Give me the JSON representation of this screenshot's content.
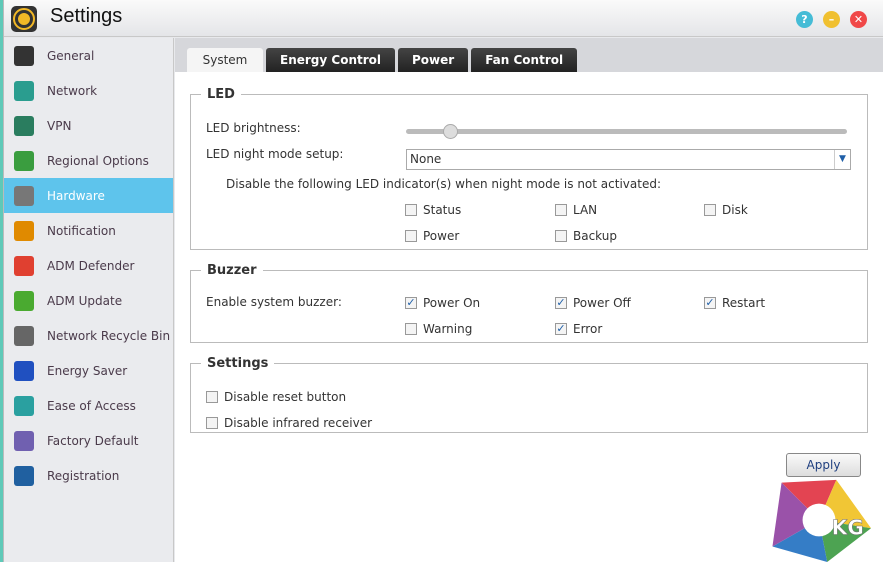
{
  "window": {
    "title": "Settings"
  },
  "sidebar": {
    "items": [
      {
        "label": "General",
        "color": "#333"
      },
      {
        "label": "Network",
        "color": "#2a9d8f"
      },
      {
        "label": "VPN",
        "color": "#2a7d5f"
      },
      {
        "label": "Regional Options",
        "color": "#3a9d3f"
      },
      {
        "label": "Hardware",
        "color": "#777"
      },
      {
        "label": "Notification",
        "color": "#e08a00"
      },
      {
        "label": "ADM Defender",
        "color": "#e04030"
      },
      {
        "label": "ADM Update",
        "color": "#4aaa30"
      },
      {
        "label": "Network Recycle Bin",
        "color": "#666"
      },
      {
        "label": "Energy Saver",
        "color": "#2050c0"
      },
      {
        "label": "Ease of Access",
        "color": "#2aa0a0"
      },
      {
        "label": "Factory Default",
        "color": "#7060b0"
      },
      {
        "label": "Registration",
        "color": "#2060a0"
      }
    ],
    "active": 4
  },
  "tabs": [
    "System",
    "Energy Control",
    "Power",
    "Fan Control"
  ],
  "led": {
    "legend": "LED",
    "brightness_label": "LED brightness:",
    "brightness_value": 0.1,
    "night_label": "LED night mode setup:",
    "night_value": "None",
    "disable_text": "Disable the following LED indicator(s) when night mode is not activated:",
    "indicators": [
      {
        "label": "Status",
        "checked": false
      },
      {
        "label": "LAN",
        "checked": false
      },
      {
        "label": "Disk",
        "checked": false
      },
      {
        "label": "Power",
        "checked": false
      },
      {
        "label": "Backup",
        "checked": false
      }
    ]
  },
  "buzzer": {
    "legend": "Buzzer",
    "label": "Enable system buzzer:",
    "options": [
      {
        "label": "Power On",
        "checked": true
      },
      {
        "label": "Power Off",
        "checked": true
      },
      {
        "label": "Restart",
        "checked": true
      },
      {
        "label": "Warning",
        "checked": false
      },
      {
        "label": "Error",
        "checked": true
      }
    ]
  },
  "settings": {
    "legend": "Settings",
    "options": [
      {
        "label": "Disable reset button",
        "checked": false
      },
      {
        "label": "Disable infrared receiver",
        "checked": false
      }
    ]
  },
  "apply_label": "Apply",
  "watermark": "KG"
}
